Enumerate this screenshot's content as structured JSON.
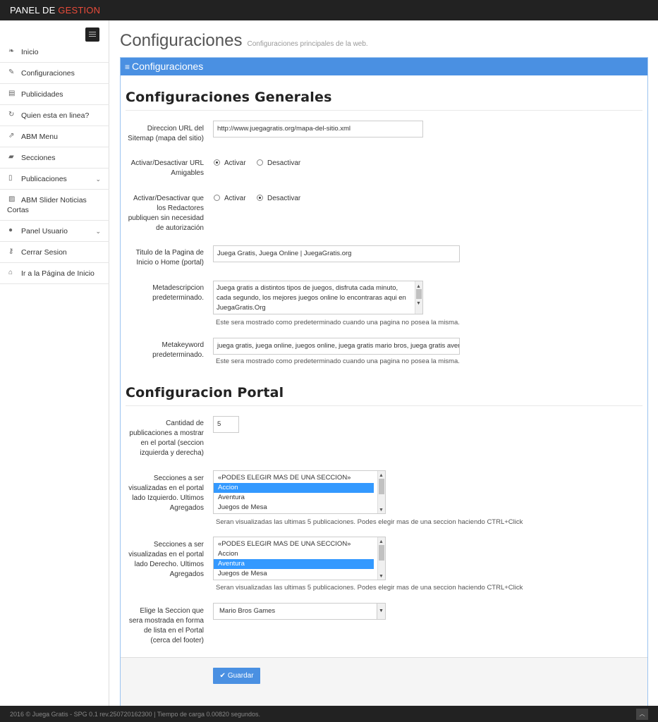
{
  "brand": {
    "part1": "PANEL DE",
    "part2": "GESTION"
  },
  "sidebar": {
    "items": [
      {
        "label": "Inicio",
        "icon": "leaf-icon",
        "glyph": "❧"
      },
      {
        "label": "Configuraciones",
        "icon": "edit-icon",
        "glyph": "✎"
      },
      {
        "label": "Publicidades",
        "icon": "gift-icon",
        "glyph": "▤"
      },
      {
        "label": "Quien esta en linea?",
        "icon": "refresh-icon",
        "glyph": "↻"
      },
      {
        "label": "ABM Menu",
        "icon": "external-link-icon",
        "glyph": "⇗"
      },
      {
        "label": "Secciones",
        "icon": "folder-icon",
        "glyph": "▰"
      },
      {
        "label": "Publicaciones",
        "icon": "file-icon",
        "glyph": "▯",
        "chevron": "⌄"
      },
      {
        "label": "ABM Slider Noticias Cortas",
        "icon": "image-icon",
        "glyph": "▨"
      },
      {
        "label": "Panel Usuario",
        "icon": "user-icon",
        "glyph": "●",
        "chevron": "⌄"
      },
      {
        "label": "Cerrar Sesion",
        "icon": "key-icon",
        "glyph": "⚷"
      },
      {
        "label": "Ir a la Página de Inicio",
        "icon": "home-icon",
        "glyph": "⌂"
      }
    ]
  },
  "page": {
    "title": "Configuraciones",
    "subtitle": "Configuraciones principales de la web."
  },
  "panel": {
    "title": "Configuraciones",
    "hamb": "≡"
  },
  "general": {
    "title": "Configuraciones Generales",
    "sitemap": {
      "label": "Direccion URL del Sitemap (mapa del sitio)",
      "value": "http://www.juegagratis.org/mapa-del-sitio.xml"
    },
    "friendly_urls": {
      "label": "Activar/Desactivar URL Amigables",
      "opt1": "Activar",
      "opt2": "Desactivar",
      "selected": "Activar"
    },
    "editors_publish": {
      "label": "Activar/Desactivar que los Redactores publiquen sin necesidad de autorización",
      "opt1": "Activar",
      "opt2": "Desactivar",
      "selected": "Desactivar"
    },
    "home_title": {
      "label": "Titulo de la Pagina de Inicio o Home (portal)",
      "value": "Juega Gratis, Juega Online | JuegaGratis.org"
    },
    "metadesc": {
      "label": "Metadescripcion predeterminado.",
      "value": "Juega gratis a distintos tipos de juegos, disfruta cada minuto, cada segundo, los mejores juegos online lo encontraras aqui en JuegaGratis.Org",
      "help": "Este sera mostrado como predeterminado cuando una pagina no posea la misma."
    },
    "metakeyword": {
      "label": "Metakeyword predeterminado.",
      "value": "juega gratis, juega online, juegos online, juega gratis mario bros, juega gratis aventura",
      "help": "Este sera mostrado como predeterminado cuando una pagina no posea la misma."
    }
  },
  "portal": {
    "title": "Configuracion Portal",
    "count": {
      "label": "Cantidad de publicaciones a mostrar en el portal (seccion izquierda y derecha)",
      "value": "5"
    },
    "left": {
      "label": "Secciones a ser visualizadas en el portal lado Izquierdo. Ultimos Agregados",
      "options": [
        "«PODES ELEGIR MAS DE UNA SECCION»",
        "Accion",
        "Aventura",
        "Juegos de Mesa"
      ],
      "selected": "Accion",
      "help": "Seran visualizadas las ultimas 5 publicaciones. Podes elegir mas de una seccion haciendo CTRL+Click"
    },
    "right": {
      "label": "Secciones a ser visualizadas en el portal lado Derecho. Ultimos Agregados",
      "options": [
        "«PODES ELEGIR MAS DE UNA SECCION»",
        "Accion",
        "Aventura",
        "Juegos de Mesa"
      ],
      "selected": "Aventura",
      "help": "Seran visualizadas las ultimas 5 publicaciones. Podes elegir mas de una seccion haciendo CTRL+Click"
    },
    "footer_section": {
      "label": "Elige la Seccion que sera mostrada en forma de lista en el Portal (cerca del footer)",
      "value": "Mario Bros Games"
    }
  },
  "actions": {
    "save": "Guardar",
    "save_glyph": "✔"
  },
  "footer": {
    "text": "2016 © Juega Gratis - SPG 0.1 rev.250720162300 | Tiempo de carga 0.00820 segundos.",
    "top_glyph": "︿"
  },
  "colors": {
    "accent": "#4a90e2",
    "brand_accent": "#e84b3a",
    "dark": "#222222"
  }
}
